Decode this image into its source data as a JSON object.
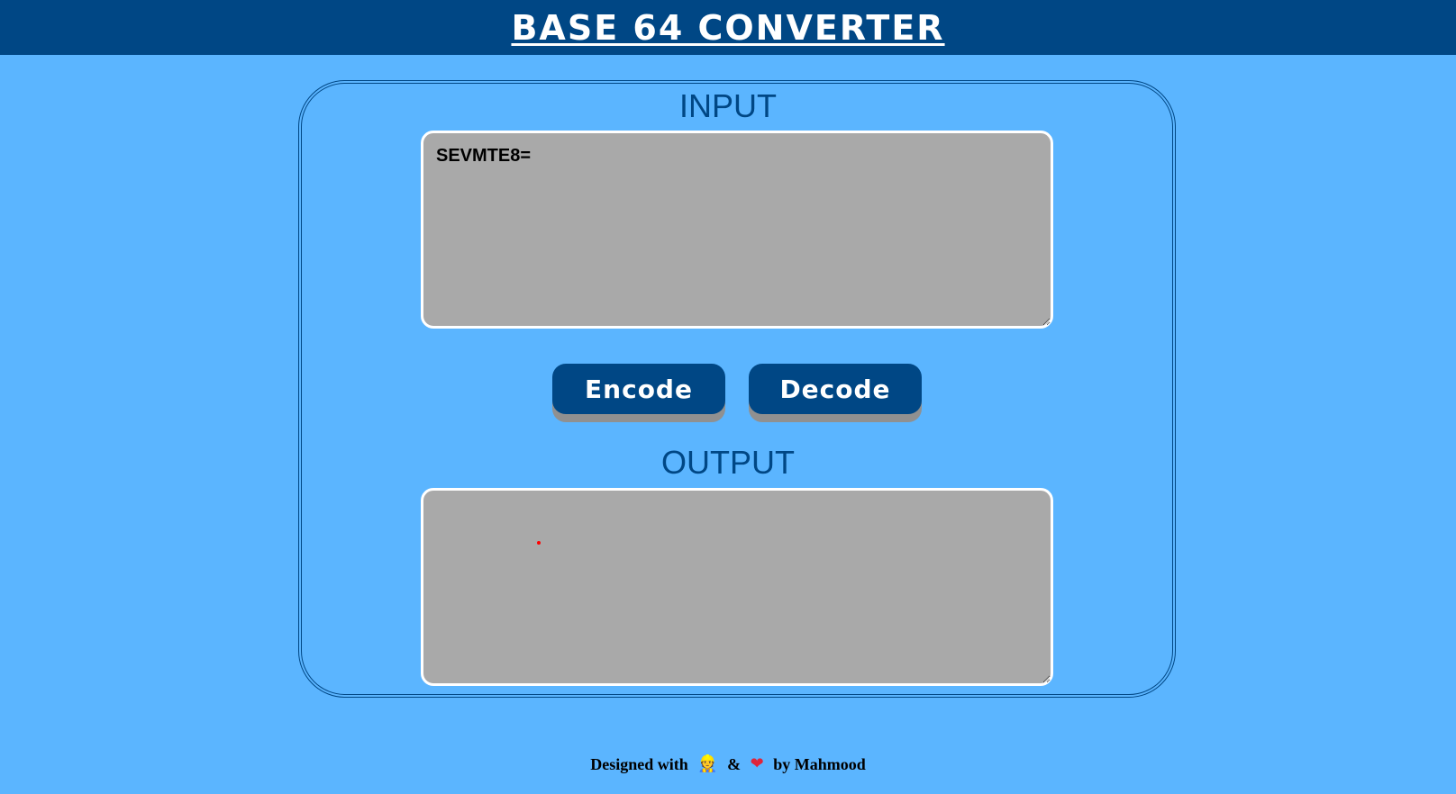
{
  "header": {
    "title": "BASE 64 CONVERTER"
  },
  "input": {
    "title": "INPUT",
    "value": "SEVMTE8="
  },
  "buttons": {
    "encode": "Encode",
    "decode": "Decode"
  },
  "output": {
    "title": "OUTPUT",
    "value": ""
  },
  "footer": {
    "prefix": "Designed with",
    "worker_glyph": "👷",
    "ampersand": "&",
    "heart_glyph": "❤",
    "suffix": "by Mahmood"
  },
  "colors": {
    "background": "#5bb5ff",
    "header": "#004785",
    "accent": "#004785",
    "textarea": "#a9a9a9",
    "button_shadow": "#909090"
  },
  "icons": {
    "worker": "construction-worker-icon",
    "heart": "heart-icon"
  }
}
